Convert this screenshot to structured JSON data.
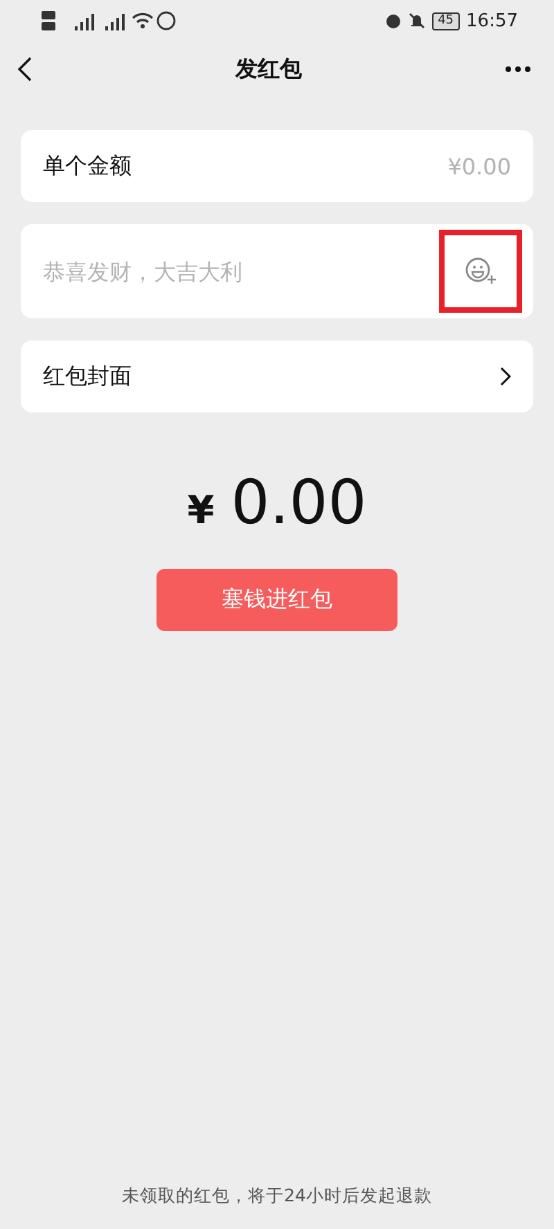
{
  "status_bar": {
    "battery": "45",
    "time": "16:57"
  },
  "nav": {
    "title": "发红包"
  },
  "amount_row": {
    "label": "单个金额",
    "placeholder": "¥0.00"
  },
  "greeting": {
    "placeholder": "恭喜发财，大吉大利",
    "highlighted": true
  },
  "cover_row": {
    "label": "红包封面"
  },
  "total": {
    "currency": "¥",
    "value": "0.00"
  },
  "submit": {
    "label": "塞钱进红包"
  },
  "footer": "未领取的红包，将于24小时后发起退款"
}
